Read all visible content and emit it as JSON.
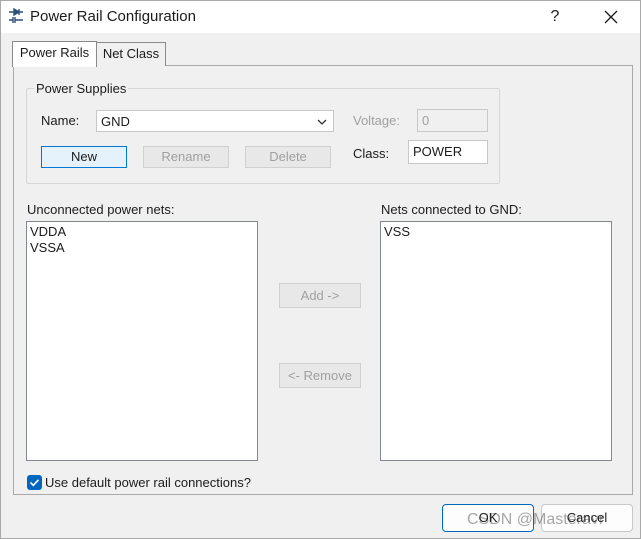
{
  "window": {
    "title": "Power Rail Configuration",
    "help_label": "?"
  },
  "tabs": [
    {
      "label": "Power Rails",
      "active": true
    },
    {
      "label": "Net Class",
      "active": false
    }
  ],
  "power_supplies": {
    "group_title": "Power Supplies",
    "name_label": "Name:",
    "name_value": "GND",
    "voltage_label": "Voltage:",
    "voltage_value": "0",
    "class_label": "Class:",
    "class_value": "POWER",
    "buttons": {
      "new": "New",
      "rename": "Rename",
      "delete": "Delete"
    }
  },
  "unconnected": {
    "label": "Unconnected power nets:",
    "items": [
      "VDDA",
      "VSSA"
    ]
  },
  "connected": {
    "label": "Nets connected to GND:",
    "items": [
      "VSS"
    ]
  },
  "transfer": {
    "add": "Add ->",
    "remove": "<- Remove"
  },
  "options": {
    "use_default_label": "Use default power rail connections?",
    "use_default_checked": true
  },
  "footer": {
    "ok": "OK",
    "cancel": "Cancel"
  },
  "watermark": "CSDN @Masteravr",
  "colors": {
    "accent": "#0067c0",
    "default_button_border": "#0078d7"
  }
}
